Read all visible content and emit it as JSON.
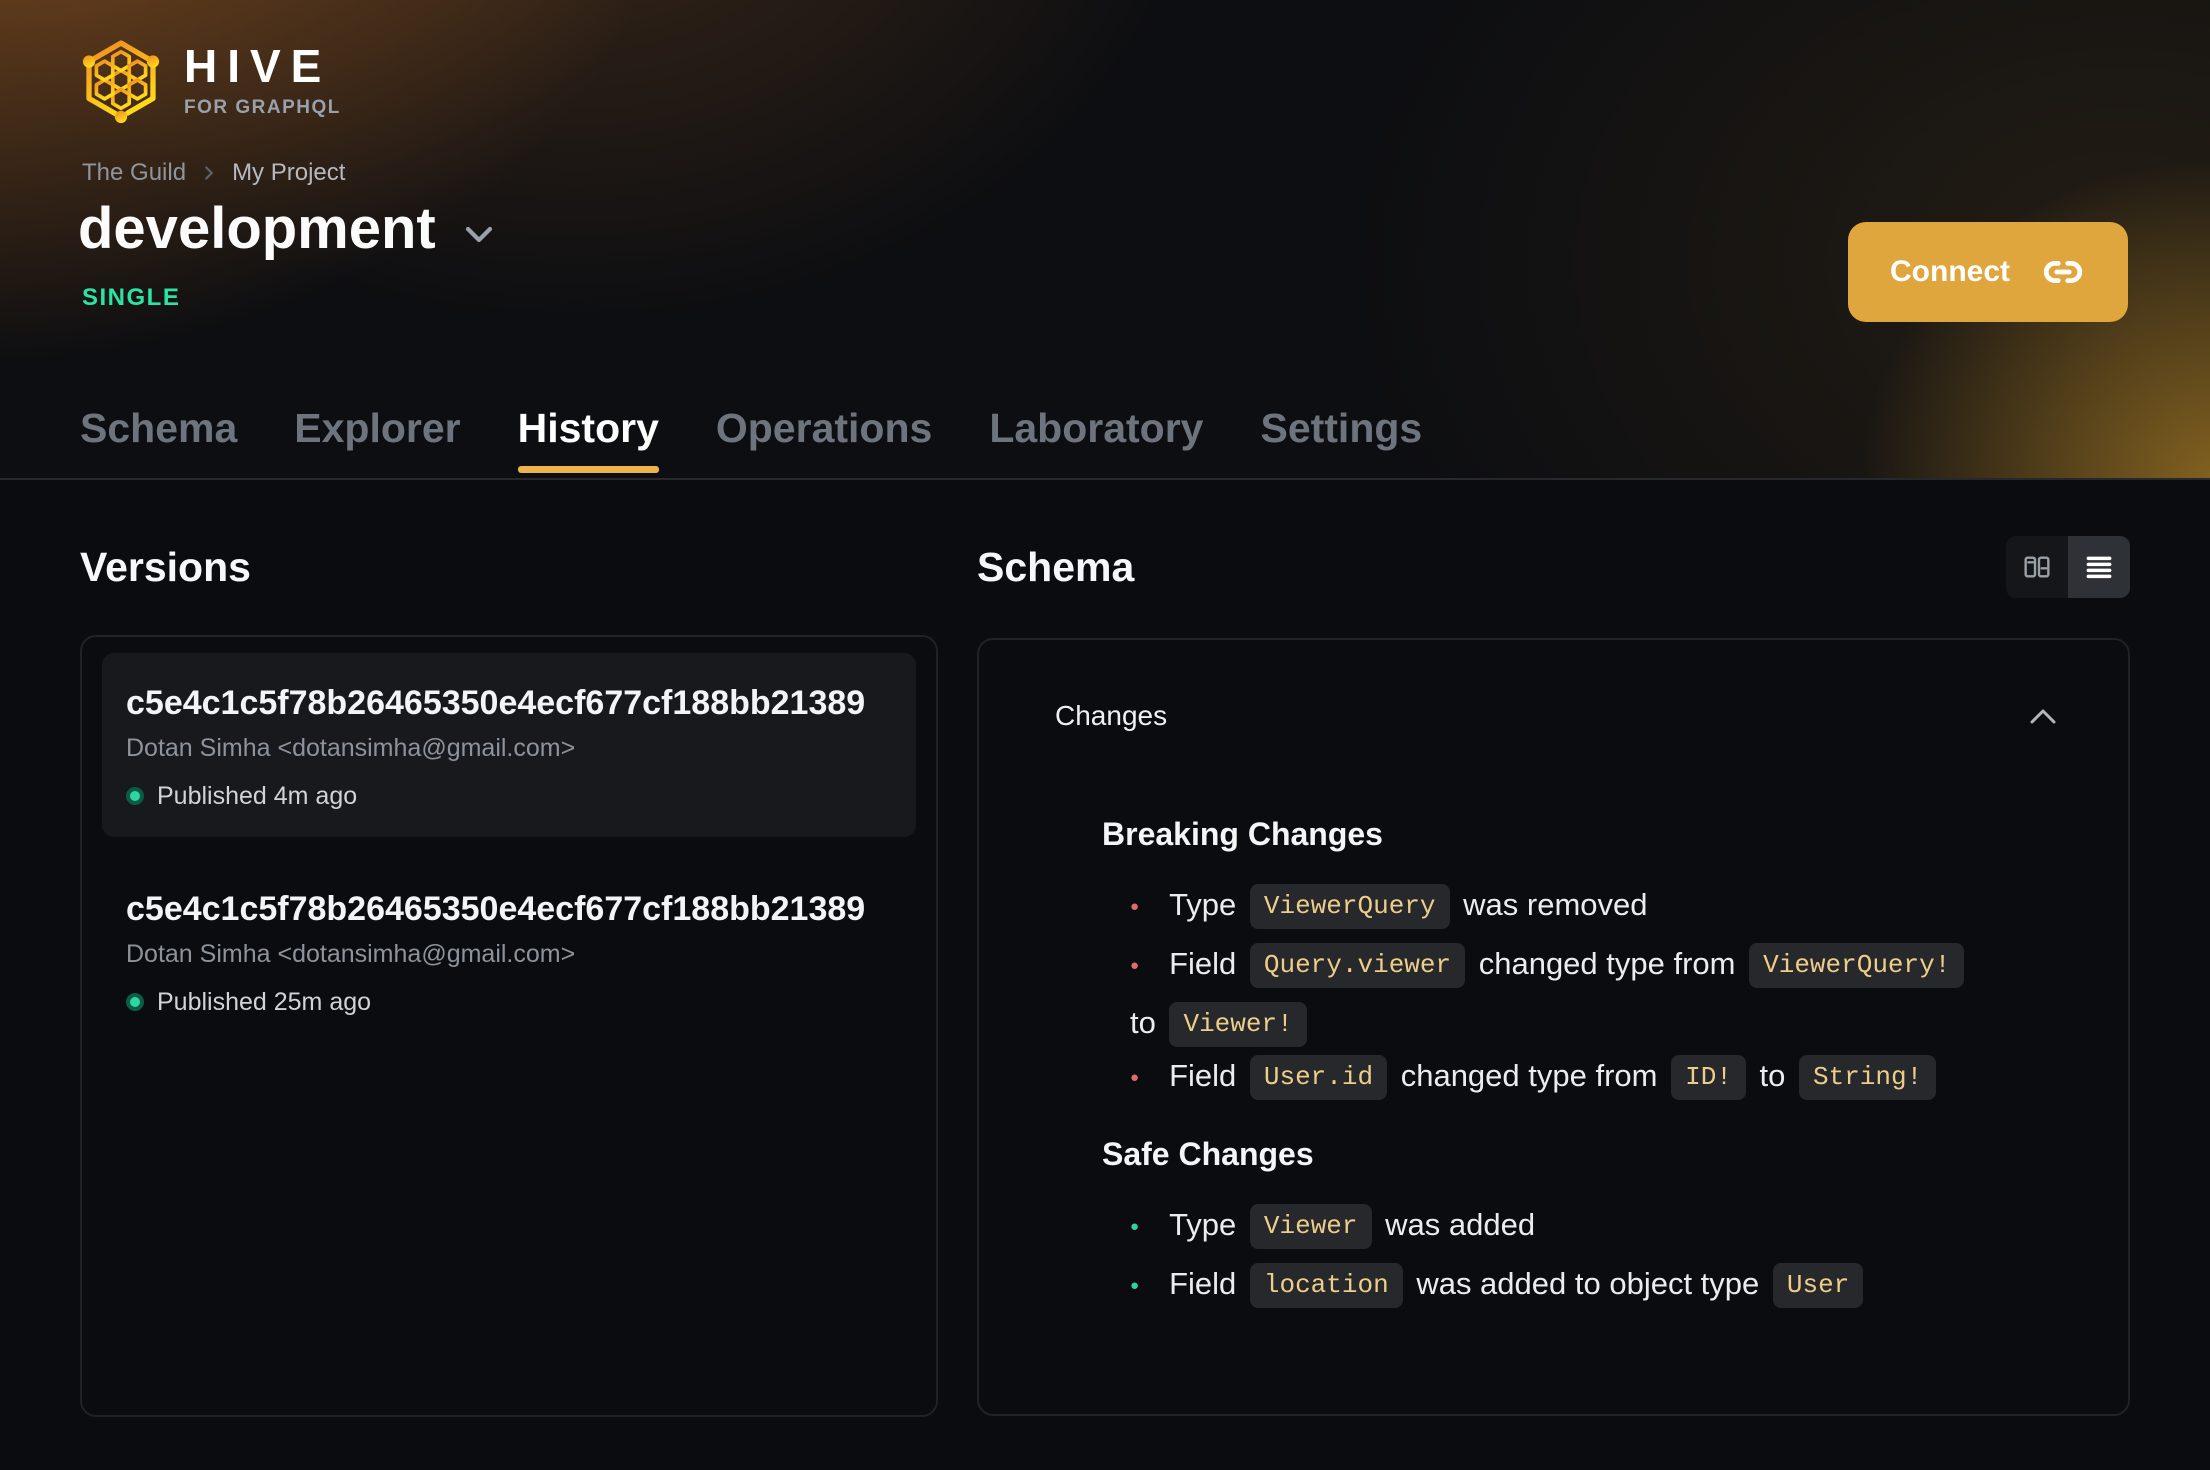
{
  "brand": {
    "name": "HIVE",
    "tagline": "FOR GRAPHQL"
  },
  "breadcrumb": {
    "org": "The Guild",
    "project": "My Project"
  },
  "target": {
    "name": "development",
    "badge": "SINGLE"
  },
  "connect": {
    "label": "Connect"
  },
  "tabs": [
    {
      "label": "Schema",
      "active": false
    },
    {
      "label": "Explorer",
      "active": false
    },
    {
      "label": "History",
      "active": true
    },
    {
      "label": "Operations",
      "active": false
    },
    {
      "label": "Laboratory",
      "active": false
    },
    {
      "label": "Settings",
      "active": false
    }
  ],
  "versions": {
    "title": "Versions",
    "items": [
      {
        "hash": "c5e4c1c5f78b26465350e4ecf677cf188bb21389",
        "author": "Dotan Simha <dotansimha@gmail.com>",
        "status": "Published 4m ago",
        "selected": true
      },
      {
        "hash": "c5e4c1c5f78b26465350e4ecf677cf188bb21389",
        "author": "Dotan Simha <dotansimha@gmail.com>",
        "status": "Published 25m ago",
        "selected": false
      }
    ]
  },
  "schema_section": {
    "title": "Schema",
    "changes_label": "Changes",
    "groups": [
      {
        "id": "breaking",
        "title": "Breaking Changes",
        "bullet_color": "#e06a72",
        "items": [
          [
            {
              "text": "Type "
            },
            {
              "code": "ViewerQuery"
            },
            {
              "text": " was removed"
            }
          ],
          [
            {
              "text": "Field "
            },
            {
              "code": "Query.viewer"
            },
            {
              "text": " changed type from "
            },
            {
              "code": "ViewerQuery!"
            },
            {
              "text": " "
            },
            {
              "nowrap": [
                {
                  "text": "to "
                },
                {
                  "code": "Viewer!"
                }
              ]
            }
          ],
          [
            {
              "text": "Field "
            },
            {
              "code": "User.id"
            },
            {
              "text": " changed type from "
            },
            {
              "code": "ID!"
            },
            {
              "text": " to "
            },
            {
              "code": "String!"
            }
          ]
        ]
      },
      {
        "id": "safe",
        "title": "Safe Changes",
        "bullet_color": "#2fd49d",
        "items": [
          [
            {
              "text": "Type "
            },
            {
              "code": "Viewer"
            },
            {
              "text": " was added"
            }
          ],
          [
            {
              "text": "Field "
            },
            {
              "code": "location"
            },
            {
              "text": " was added to object type "
            },
            {
              "code": "User"
            }
          ]
        ]
      }
    ]
  },
  "colors": {
    "page_bg": "#0a0c0f",
    "accent": "#dfa63e",
    "tab_underline": "#edb14d",
    "badge_green": "#2be3a3",
    "status_dot": "#2fd7a0",
    "card_bg": "#17191d",
    "panel_border": "#1f2227",
    "chip_bg": "#26282c",
    "chip_text": "#ecce8a"
  }
}
